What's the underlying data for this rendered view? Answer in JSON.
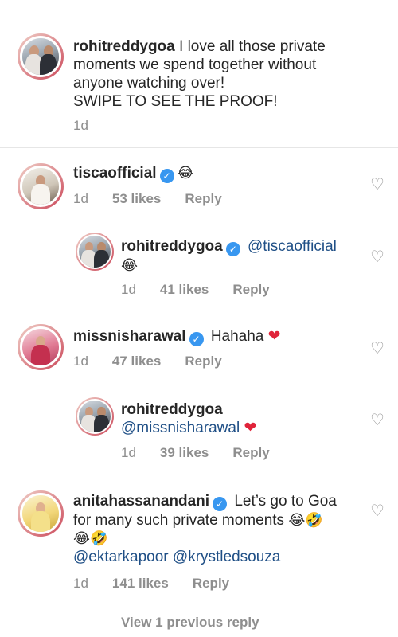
{
  "caption": {
    "username": "rohitreddygoa",
    "text_line1": "I love all those private",
    "text_line2": "moments we spend together without",
    "text_line3": "anyone watching over!",
    "text_line4": "SWIPE TO SEE THE PROOF!",
    "time": "1d"
  },
  "comments": [
    {
      "username": "tiscaofficial",
      "text": "😂",
      "time": "1d",
      "likes": "53 likes",
      "reply": "Reply"
    },
    {
      "username": "rohitreddygoa",
      "mention": "@tiscaofficial",
      "text": "😂",
      "time": "1d",
      "likes": "41 likes",
      "reply": "Reply"
    },
    {
      "username": "missnisharawal",
      "text": "Hahaha",
      "time": "1d",
      "likes": "47 likes",
      "reply": "Reply"
    },
    {
      "username": "rohitreddygoa",
      "mention": "@missnisharawal",
      "time": "1d",
      "likes": "39 likes",
      "reply": "Reply"
    },
    {
      "username": "anitahassanandani",
      "text_line1": "Let’s go to Goa",
      "text_line2": "for many such private moments",
      "emoji_line2": "😂🤣",
      "emoji_line3": "😂🤣",
      "mentions": "@ektarkapoor @krystledsouza",
      "time": "1d",
      "likes": "141 likes",
      "reply": "Reply"
    }
  ],
  "view_previous": "View 1 previous reply",
  "icons": {
    "like": "heart-outline-icon",
    "verified": "verified-badge-icon"
  },
  "colors": {
    "verified": "#3897f0",
    "heart": "#e0243a",
    "secondary_text": "#8e8e8e"
  }
}
